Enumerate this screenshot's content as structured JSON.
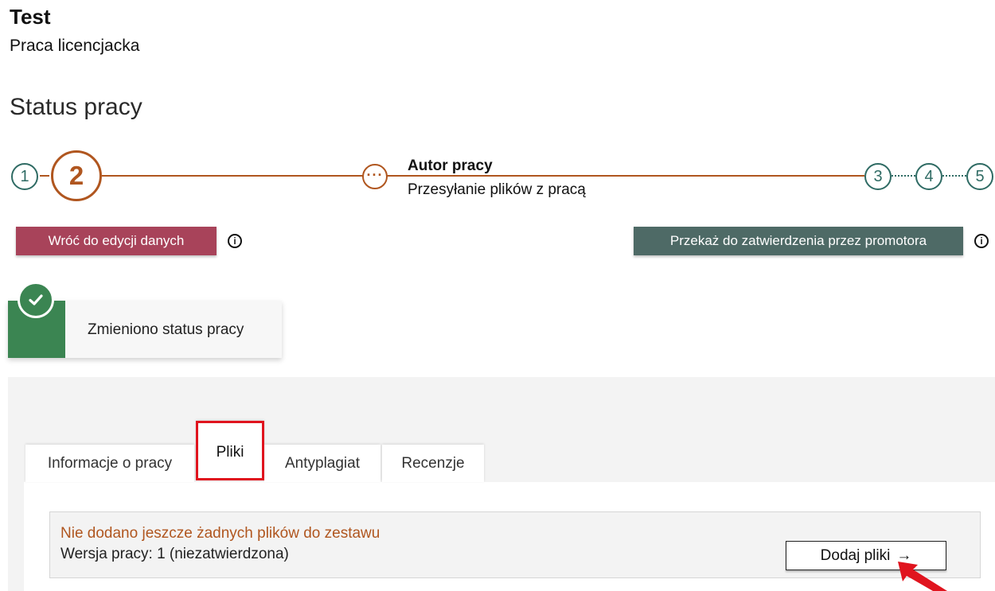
{
  "header": {
    "title": "Test",
    "subtitle": "Praca licencjacka",
    "status_heading": "Status pracy"
  },
  "stepper": {
    "steps": [
      "1",
      "2",
      "3",
      "4",
      "5"
    ],
    "current_step": "2",
    "sub_step_icon": "ellipsis-icon",
    "stage_role": "Autor pracy",
    "stage_description": "Przesyłanie plików z pracą",
    "colors": {
      "active": "#b0561f",
      "inactive": "#2f6b64"
    }
  },
  "actions": {
    "back_label": "Wróć do edycji danych",
    "forward_label": "Przekaż do zatwierdzenia przez promotora",
    "info_icon": "info-icon"
  },
  "toast": {
    "message": "Zmieniono status pracy",
    "icon": "check-icon",
    "color": "#3b8552"
  },
  "tabs": [
    {
      "label": "Informacje o pracy",
      "active": false
    },
    {
      "label": "Pliki",
      "active": true
    },
    {
      "label": "Antyplagiat",
      "active": false
    },
    {
      "label": "Recenzje",
      "active": false
    }
  ],
  "files_panel": {
    "warning": "Nie dodano jeszcze żadnych plików do zestawu",
    "version": "Wersja pracy: 1 (niezatwierdzona)",
    "add_files_label": "Dodaj pliki",
    "add_files_icon": "arrow-right-icon"
  },
  "annotations": {
    "highlight_color": "#e0141e",
    "pointer_icon": "red-arrow-icon"
  }
}
